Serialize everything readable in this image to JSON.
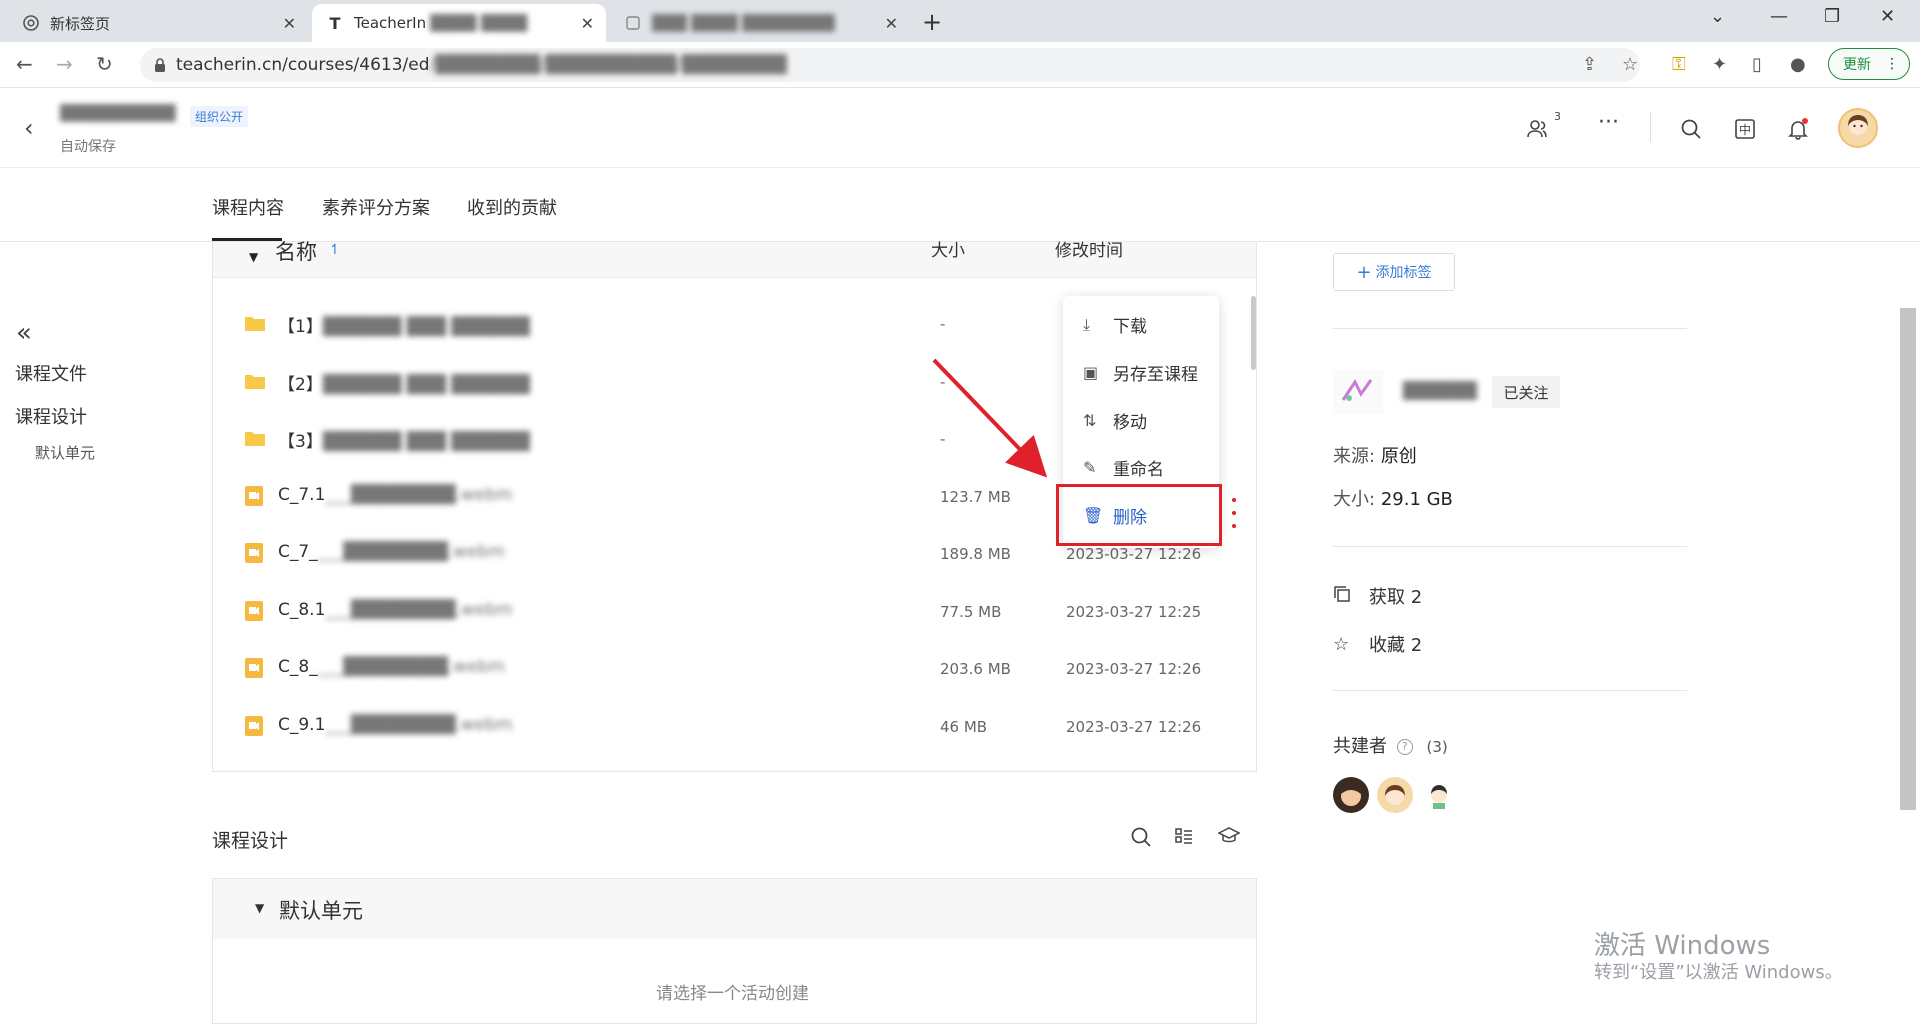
{
  "browser": {
    "tabs": [
      {
        "title": "新标签页"
      },
      {
        "title": "TeacherIn"
      },
      {
        "title": ""
      }
    ],
    "url": "teacherin.cn/courses/4613/ed",
    "update_label": "更新"
  },
  "header": {
    "public_badge": "组织公开",
    "autosave": "自动保存",
    "members_count": "3"
  },
  "course_tabs": [
    "课程内容",
    "素养评分方案",
    "收到的贡献"
  ],
  "sidebar": {
    "items": [
      "课程文件",
      "课程设计"
    ],
    "sub_item": "默认单元"
  },
  "file_table": {
    "headers": {
      "name": "名称",
      "size": "大小",
      "modified": "修改时间"
    },
    "rows": [
      {
        "type": "folder",
        "prefix": "【1】",
        "size": "-",
        "time": ""
      },
      {
        "type": "folder",
        "prefix": "【2】",
        "size": "-",
        "time": ""
      },
      {
        "type": "folder",
        "prefix": "【3】",
        "size": "-",
        "time": ""
      },
      {
        "type": "video",
        "prefix": "C_7.1",
        "size": "123.7 MB",
        "time": ""
      },
      {
        "type": "video",
        "prefix": "C_7_",
        "size": "189.8 MB",
        "time": "2023-03-27 12:26"
      },
      {
        "type": "video",
        "prefix": "C_8.1",
        "size": "77.5 MB",
        "time": "2023-03-27 12:25"
      },
      {
        "type": "video",
        "prefix": "C_8_",
        "size": "203.6 MB",
        "time": "2023-03-27 12:26"
      },
      {
        "type": "video",
        "prefix": "C_9.1",
        "size": "46 MB",
        "time": "2023-03-27 12:26"
      }
    ]
  },
  "context_menu": {
    "items": [
      "下载",
      "另存至课程",
      "移动",
      "重命名",
      "删除"
    ],
    "highlighted": "删除"
  },
  "course_design": {
    "title": "课程设计",
    "unit_name": "默认单元",
    "empty_hint": "请选择一个活动创建"
  },
  "right_panel": {
    "add_tag": "添加标签",
    "follow": "已关注",
    "source_label": "来源:",
    "source_value": "原创",
    "size_label": "大小:",
    "size_value": "29.1 GB",
    "fetch": "获取 2",
    "favorite": "收藏 2",
    "cocreators_label": "共建者",
    "cocreators_count": "(3)"
  },
  "watermark": {
    "line1": "激活 Windows",
    "line2": "转到“设置”以激活 Windows。"
  },
  "colors": {
    "accent_blue": "#2b62c8",
    "annotation_red": "#e0202a",
    "folder_yellow": "#f7c948",
    "video_orange": "#f5b942"
  }
}
